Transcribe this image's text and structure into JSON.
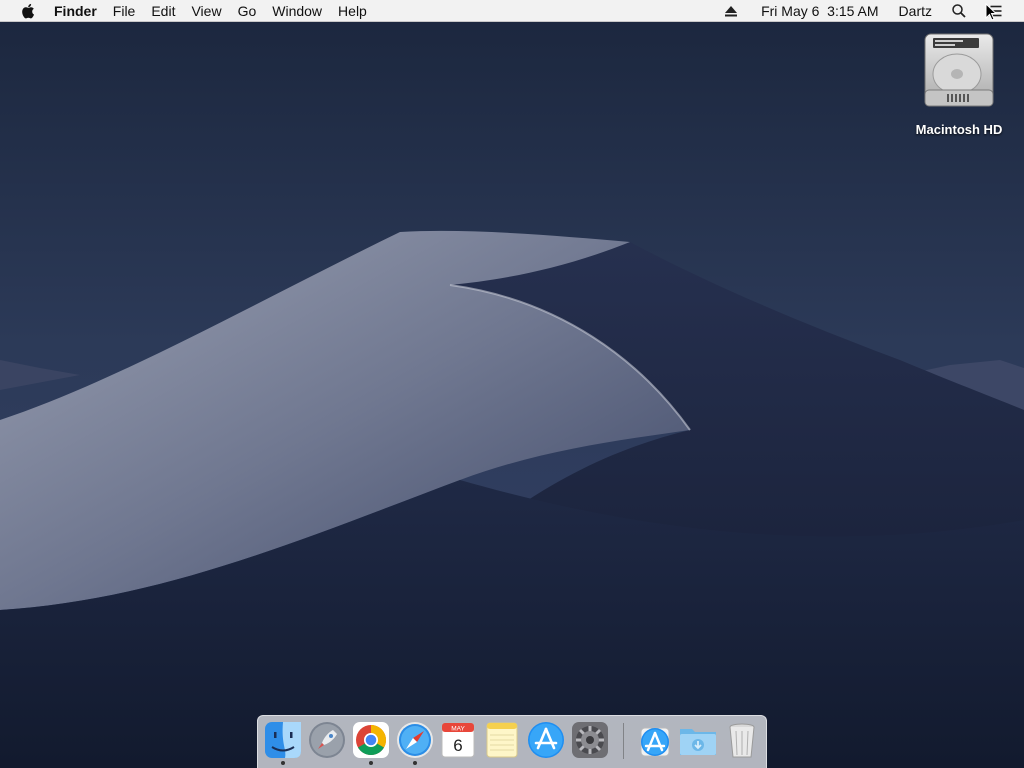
{
  "menubar": {
    "app_name": "Finder",
    "menus": [
      "File",
      "Edit",
      "View",
      "Go",
      "Window",
      "Help"
    ],
    "date_time": "Fri May 6  3:15 AM",
    "user": "Dartz",
    "status_icons": [
      "eject-icon",
      "spotlight-search-icon",
      "notification-center-icon"
    ]
  },
  "desktop": {
    "icons": [
      {
        "label": "Macintosh HD",
        "icon": "hard-drive-icon"
      }
    ]
  },
  "dock": {
    "apps": [
      {
        "name": "Finder",
        "icon": "finder-icon",
        "running": true
      },
      {
        "name": "Launchpad",
        "icon": "launchpad-icon",
        "running": false
      },
      {
        "name": "Google Chrome",
        "icon": "chrome-icon",
        "running": true
      },
      {
        "name": "Safari",
        "icon": "safari-icon",
        "running": true
      },
      {
        "name": "Calendar",
        "icon": "calendar-icon",
        "running": false,
        "month": "MAY",
        "day": "6"
      },
      {
        "name": "Notes",
        "icon": "notes-icon",
        "running": false
      },
      {
        "name": "App Store",
        "icon": "app-store-icon",
        "running": false
      },
      {
        "name": "System Preferences",
        "icon": "system-preferences-icon",
        "running": false
      },
      {
        "name": "Applications",
        "icon": "applications-stack-icon",
        "running": false
      },
      {
        "name": "Downloads",
        "icon": "downloads-folder-icon",
        "running": false
      },
      {
        "name": "Trash",
        "icon": "trash-icon",
        "running": false
      }
    ]
  },
  "colors": {
    "menubar_bg": "#f2f2f2",
    "sky": "#1e2a44",
    "dune_light": "#8c93a6",
    "dune_dark": "#1c2540"
  }
}
